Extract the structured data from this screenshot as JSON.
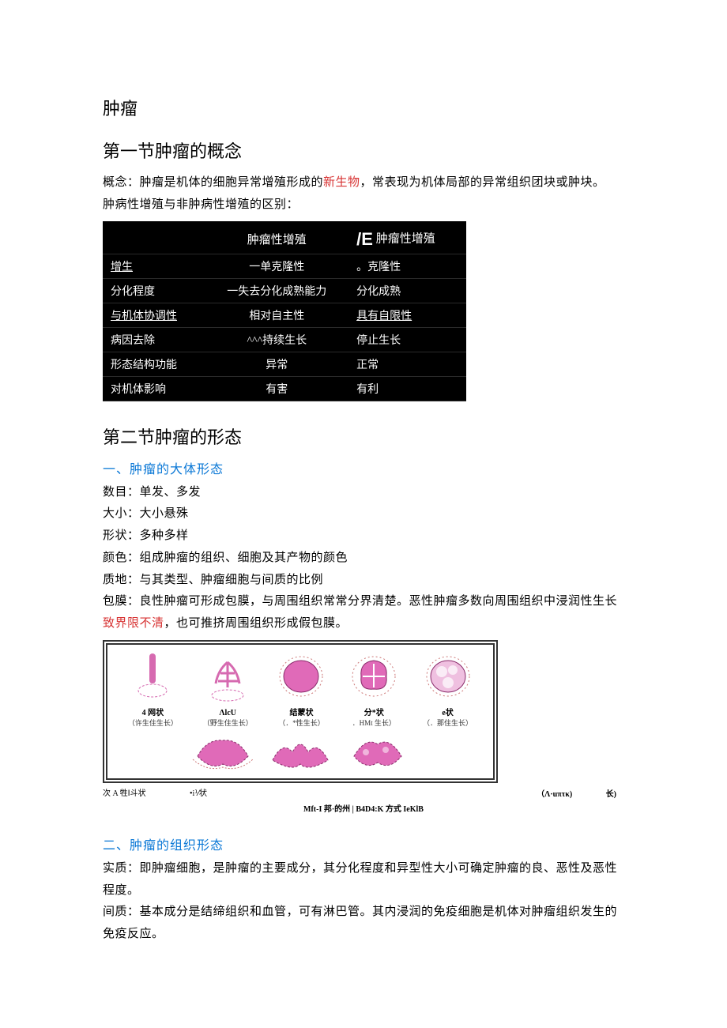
{
  "doc": {
    "title": "肿瘤",
    "section1": {
      "heading": "第一节肿瘤的概念",
      "concept_prefix": "概念：肿瘤是机体的细胞异常增殖形成的",
      "concept_red": "新生物",
      "concept_suffix": "，常表现为机体局部的异常组织团块或肿块。",
      "diff_intro": "肿病性增殖与非肿病性增殖的区别："
    },
    "table": {
      "h1": "",
      "h2": "肿瘤性增殖",
      "h3_prefix": "/E",
      "h3_suffix": " 肿瘤性增殖",
      "rows": [
        {
          "c1": "增生",
          "c2": "一单克隆性",
          "c3": "。克隆性",
          "c1u": true
        },
        {
          "c1": "分化程度",
          "c2": "一失去分化成熟能力",
          "c3": "分化成熟"
        },
        {
          "c1": "与机体协调性",
          "c2": "相对自主性",
          "c3": "具有自限性",
          "c1u": true,
          "c3u": true
        },
        {
          "c1": "病因去除",
          "c2": "^^^持续生长",
          "c3": "停止生长"
        },
        {
          "c1": "形态结构功能",
          "c2": "异常",
          "c3": "正常"
        },
        {
          "c1": "对机体影响",
          "c2": "有害",
          "c3": "有利"
        }
      ]
    },
    "section2": {
      "heading": "第二节肿瘤的形态",
      "sub_a": "一、肿瘤的大体形态",
      "lines_a": [
        "数目：单发、多发",
        "大小：大小悬殊",
        "形状：多种多样",
        "颜色：组成肿瘤的组织、细胞及其产物的颜色",
        "质地：与其类型、肿瘤细胞与间质的比例"
      ],
      "capsule_prefix": "包膜：良性肿瘤可形成包膜，与周围组织常常分界清楚。恶性肿瘤多数向周围组织中浸润性生长",
      "capsule_red": "致界限不清",
      "capsule_suffix": "，也可推挤周围组织形成假包膜。",
      "sub_b": "二、肿瘤的组织形态",
      "line_b1": "实质：即肿瘤细胞，是肿瘤的主要成分，其分化程度和异型性大小可确定肿瘤的良、恶性及恶性程度。",
      "line_b2": "间质：基本成分是结缔组织和血管，可有淋巴管。其内浸润的免疫细胞是机体对肿瘤组织发生的免疫反应。"
    },
    "figure": {
      "top": [
        {
          "label": "4 网状",
          "sub": "（许生住生长）"
        },
        {
          "label": "ΛlcU",
          "sub": "（野生住生长）"
        },
        {
          "label": "结蒙状",
          "sub": "（．*性生长）"
        },
        {
          "label": "分*状",
          "sub": "．HMt 生长）"
        },
        {
          "label": "e状",
          "sub": "（．那住生长）"
        }
      ],
      "below_left": "次 A 牲Ⅰ斗状",
      "below_mid": "•i⅟状",
      "right_note": "（Λ·uπτκ)",
      "right_note2": "长)",
      "caption": "Mft-I 邦·的州 | B4D4:K 方式 IeKlB"
    }
  }
}
